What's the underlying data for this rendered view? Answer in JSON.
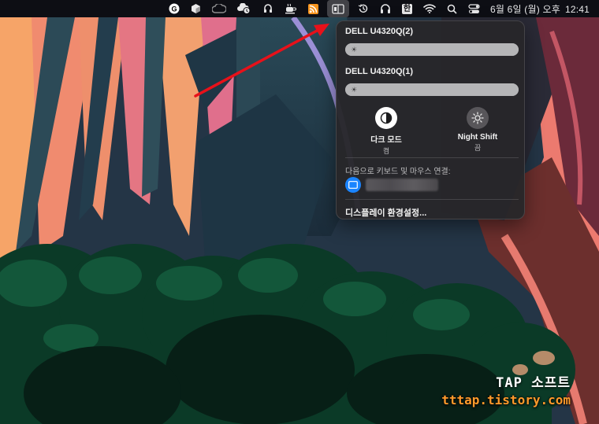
{
  "menubar": {
    "clock": {
      "date": "6월 6일 (월) 오후",
      "time": "12:41"
    },
    "input_source": "한"
  },
  "display_panel": {
    "displays": [
      {
        "name": "DELL U4320Q(2)",
        "brightness": 1.0
      },
      {
        "name": "DELL U4320Q(1)",
        "brightness": 1.0
      }
    ],
    "dark_mode": {
      "label": "다크 모드",
      "state": "켬"
    },
    "night_shift": {
      "label": "Night Shift",
      "state": "끔"
    },
    "link_section_label": "다음으로 키보드 및 마우스 연결:",
    "settings_link": "디스플레이 환경설정..."
  },
  "watermark": {
    "brand": "TAP 소프트",
    "url": "tttap.tistory.com"
  },
  "colors": {
    "menubar_bg": "#0c0c10",
    "panel_bg": "#28262a",
    "accent_blue": "#1a84ff",
    "arrow_red": "#e8111a",
    "watermark_orange": "#ff9a2b"
  }
}
